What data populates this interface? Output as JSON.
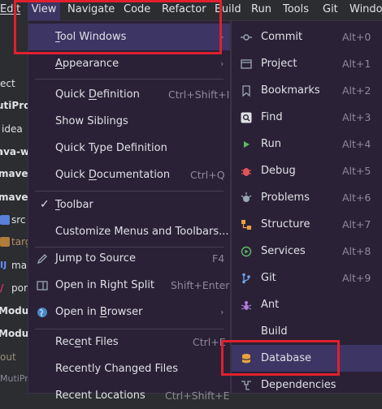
{
  "menubar": {
    "items": [
      {
        "label": "Edit"
      },
      {
        "label": "View"
      },
      {
        "label": "Navigate"
      },
      {
        "label": "Code"
      },
      {
        "label": "Refactor"
      },
      {
        "label": "Build"
      },
      {
        "label": "Run"
      },
      {
        "label": "Tools"
      },
      {
        "label": "Git"
      },
      {
        "label": "Window"
      }
    ]
  },
  "left_pane": {
    "rows": [
      {
        "text": "ect"
      },
      {
        "text": "utiProj"
      },
      {
        "text": "idea"
      },
      {
        "text": "ava-w"
      },
      {
        "text": "maver"
      },
      {
        "text": "maver"
      },
      {
        "text": "src"
      },
      {
        "text": "targ"
      },
      {
        "text": "ma"
      },
      {
        "text": "por"
      },
      {
        "text": "Modu"
      },
      {
        "text": "Modu"
      },
      {
        "text": "out"
      },
      {
        "text": "MutiPr"
      }
    ]
  },
  "view_menu": {
    "items": [
      {
        "label": "Tool Windows",
        "mnemonic": "T",
        "rest": "ool Windows",
        "shortcut": "",
        "submenu": true
      },
      {
        "label": "Appearance",
        "mnemonic": "A",
        "rest": "ppearance",
        "shortcut": "",
        "submenu": true
      },
      {
        "label": "Quick Definition",
        "mnemonic": "",
        "rest": "",
        "pre": "Quick ",
        "mid": "D",
        "post": "efinition",
        "shortcut": "Ctrl+Shift+I"
      },
      {
        "label": "Show Siblings",
        "shortcut": ""
      },
      {
        "label": "Quick Type Definition",
        "shortcut": ""
      },
      {
        "label": "Quick Documentation",
        "pre": "Quick ",
        "mid": "D",
        "post": "ocumentation",
        "shortcut": "Ctrl+Q"
      },
      {
        "label": "Toolbar",
        "mnemonic": "T",
        "rest": "oolbar",
        "checked": true
      },
      {
        "label": "Customize Menus and Toolbars...",
        "shortcut": ""
      },
      {
        "label": "Jump to Source",
        "shortcut": "F4"
      },
      {
        "label": "Open in Right Split",
        "shortcut": "Shift+Enter"
      },
      {
        "label": "Open in Browser",
        "pre": "Open in ",
        "mid": "B",
        "post": "rowser",
        "submenu": true
      },
      {
        "label": "Recent Files",
        "pre": "Rec",
        "mid": "e",
        "post": "nt Files",
        "shortcut": "Ctrl+E"
      },
      {
        "label": "Recently Changed Files",
        "shortcut": ""
      },
      {
        "label": "Recent Locations",
        "shortcut": "Ctrl+Shift+E"
      }
    ],
    "checkmark": "✓"
  },
  "tool_windows_menu": {
    "items": [
      {
        "label": "Commit",
        "shortcut": "Alt+0",
        "icon": "commit-icon"
      },
      {
        "label": "Project",
        "shortcut": "Alt+1",
        "icon": "project-icon"
      },
      {
        "label": "Bookmarks",
        "shortcut": "Alt+2",
        "icon": "bookmark-icon"
      },
      {
        "label": "Find",
        "shortcut": "Alt+3",
        "icon": "find-icon"
      },
      {
        "label": "Run",
        "shortcut": "Alt+4",
        "icon": "run-icon"
      },
      {
        "label": "Debug",
        "shortcut": "Alt+5",
        "icon": "debug-icon"
      },
      {
        "label": "Problems",
        "shortcut": "Alt+6",
        "icon": "problems-icon"
      },
      {
        "label": "Structure",
        "shortcut": "Alt+7",
        "icon": "structure-icon"
      },
      {
        "label": "Services",
        "shortcut": "Alt+8",
        "icon": "services-icon"
      },
      {
        "label": "Git",
        "shortcut": "Alt+9",
        "icon": "git-icon"
      },
      {
        "label": "Ant",
        "shortcut": "",
        "icon": "ant-icon"
      },
      {
        "label": "Build",
        "shortcut": "",
        "icon": "build-icon"
      },
      {
        "label": "Database",
        "shortcut": "",
        "icon": "database-icon"
      },
      {
        "label": "Dependencies",
        "shortcut": "",
        "icon": "dependencies-icon"
      }
    ]
  },
  "colors": {
    "menu_bg": "#2a2137",
    "selection_bg": "#3d3564",
    "highlight_border": "#e0202e",
    "shortcut_text": "#8d8998"
  }
}
